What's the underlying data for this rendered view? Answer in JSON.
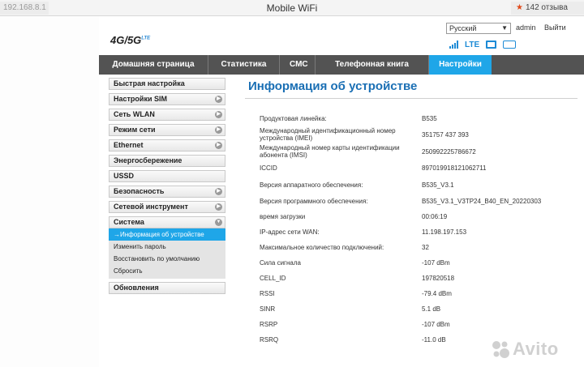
{
  "browser": {
    "address": "192.168.8.1",
    "title": "Mobile WiFi",
    "reviews": "142 отзыва"
  },
  "header": {
    "logo_main": "4G/5G",
    "logo_sub": "LTE",
    "language": "Русский",
    "user": "admin",
    "logout": "Выйти",
    "status_icons": [
      "signal-icon",
      "lte-icon",
      "wifi-icon",
      "battery-icon"
    ]
  },
  "nav": {
    "tabs": [
      {
        "label": "Домашняя страница"
      },
      {
        "label": "Статистика"
      },
      {
        "label": "СМС"
      },
      {
        "label": "Телефонная книга"
      },
      {
        "label": "Настройки"
      }
    ],
    "active_tab": "Настройки"
  },
  "sidebar": {
    "items": [
      {
        "label": "Быстрая настройка"
      },
      {
        "label": "Настройки SIM"
      },
      {
        "label": "Сеть WLAN"
      },
      {
        "label": "Режим сети"
      },
      {
        "label": "Ethernet"
      },
      {
        "label": "Энергосбережение"
      },
      {
        "label": "USSD"
      },
      {
        "label": "Безопасность"
      },
      {
        "label": "Сетевой инструмент"
      },
      {
        "label": "Система"
      },
      {
        "label": "Обновления"
      }
    ],
    "system_sub": [
      {
        "label": "→Информация об устройстве"
      },
      {
        "label": "Изменить пароль"
      },
      {
        "label": "Восстановить по умолчанию"
      },
      {
        "label": "Сбросить"
      }
    ]
  },
  "content": {
    "title": "Информация об устройстве",
    "rows": [
      {
        "label": "Продуктовая линейка:",
        "value": "B535"
      },
      {
        "label": "Международный идентификационный номер устройства (IMEI)",
        "value": "351757   437  393"
      },
      {
        "label": "Международный номер карты идентификации абонента (IMSI)",
        "value": "250992225786672"
      },
      {
        "label": "ICCID",
        "value": "897019918121062711"
      },
      {
        "label": "Версия аппаратного обеспечения:",
        "value": "B535_V3.1"
      },
      {
        "label": "Версия программного обеспечения:",
        "value": "B535_V3.1_V3TP24_B40_EN_20220303"
      },
      {
        "label": "время загрузки",
        "value": "00:06:19"
      },
      {
        "label": "IP-адрес сети WAN:",
        "value": "11.198.197.153"
      },
      {
        "label": "Максимальное количество подключений:",
        "value": "32"
      },
      {
        "label": "Сила сигнала",
        "value": "-107 dBm"
      },
      {
        "label": "CELL_ID",
        "value": "197820518"
      },
      {
        "label": "RSSI",
        "value": "-79.4 dBm"
      },
      {
        "label": "SINR",
        "value": "5.1 dB"
      },
      {
        "label": "RSRP",
        "value": "-107 dBm"
      },
      {
        "label": "RSRQ",
        "value": "-11.0 dB"
      }
    ]
  },
  "watermark": "Avito",
  "colors": {
    "accent": "#1fa6e8",
    "nav_bg": "#535353",
    "title": "#1a6fb4"
  }
}
